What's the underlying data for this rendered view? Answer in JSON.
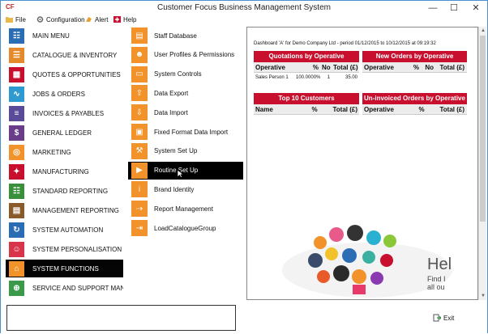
{
  "window": {
    "title": "Customer Focus Business Management System",
    "logo_text": "CF"
  },
  "menu": [
    {
      "label": "File",
      "icon": "folder-icon"
    },
    {
      "label": "Configuration",
      "icon": "gear-icon"
    },
    {
      "label": "Alert",
      "icon": "bell-icon"
    },
    {
      "label": "Help",
      "icon": "help-icon"
    }
  ],
  "nav": {
    "items": [
      {
        "label": "MAIN MENU",
        "icon": "hierarchy-icon",
        "color": "#2a6db5"
      },
      {
        "label": "CATALOGUE & INVENTORY",
        "icon": "book-icon",
        "color": "#e58a2a"
      },
      {
        "label": "QUOTES & OPPORTUNITIES",
        "icon": "calendar-icon",
        "color": "#c8102e"
      },
      {
        "label": "JOBS & ORDERS",
        "icon": "pulse-icon",
        "color": "#2e9ad0"
      },
      {
        "label": "INVOICES & PAYABLES",
        "icon": "invoice-icon",
        "color": "#5a4a9a"
      },
      {
        "label": "GENERAL LEDGER",
        "icon": "dollar-icon",
        "color": "#6a3d8a"
      },
      {
        "label": "MARKETING",
        "icon": "globe-icon",
        "color": "#f2922a"
      },
      {
        "label": "MANUFACTURING",
        "icon": "network-icon",
        "color": "#c8102e"
      },
      {
        "label": "STANDARD REPORTING",
        "icon": "report-icon",
        "color": "#3a8f3a"
      },
      {
        "label": "MANAGEMENT REPORTING",
        "icon": "chart-icon",
        "color": "#8a5a2a"
      },
      {
        "label": "SYSTEM AUTOMATION",
        "icon": "sync-icon",
        "color": "#2a6db5"
      },
      {
        "label": "SYSTEM PERSONALISATION",
        "icon": "user-icon",
        "color": "#d8344a"
      },
      {
        "label": "SYSTEM FUNCTIONS",
        "icon": "home-icon",
        "color": "#f2922a"
      },
      {
        "label": "SERVICE AND SUPPORT MANAGEMENT",
        "icon": "support-icon",
        "color": "#3a9a4a"
      }
    ],
    "selected_index": 12
  },
  "functions": {
    "items": [
      {
        "label": "Staff Database",
        "icon": "id-card-icon"
      },
      {
        "label": "User Profiles & Permissions",
        "icon": "users-icon"
      },
      {
        "label": "System Controls",
        "icon": "controls-icon"
      },
      {
        "label": "Data Export",
        "icon": "export-icon"
      },
      {
        "label": "Data Import",
        "icon": "import-icon"
      },
      {
        "label": "Fixed Format Data Import",
        "icon": "inbox-icon"
      },
      {
        "label": "System Set Up",
        "icon": "tools-icon"
      },
      {
        "label": "Routine Set Up",
        "icon": "routine-icon"
      },
      {
        "label": "Brand Identity",
        "icon": "info-icon"
      },
      {
        "label": "Report Management",
        "icon": "report-manage-icon"
      },
      {
        "label": "LoadCatalogueGroup",
        "icon": "load-icon"
      }
    ],
    "selected_index": 7
  },
  "dashboard": {
    "heading": "Dashboard 'A' for Demo Company Ltd - period 01/12/2015 to 10/12/2015 at 09:19:32",
    "quotations": {
      "title": "Quotations by Operative",
      "columns": [
        "Operative",
        "%",
        "No",
        "Total (£)"
      ],
      "rows": [
        [
          "Sales Person 1",
          "100.0000%",
          "1",
          "35.00"
        ]
      ]
    },
    "new_orders": {
      "title": "New Orders by Operative",
      "columns": [
        "Operative",
        "%",
        "No",
        "Total (£)"
      ]
    },
    "top_customers": {
      "title": "Top 10 Customers",
      "columns": [
        "Name",
        "%",
        "Total (£)"
      ]
    },
    "uninvoiced": {
      "title": "Un-invoiced Orders by Operative",
      "columns": [
        "Operative",
        "%",
        "Total (£)"
      ]
    },
    "help_banner": {
      "big": "Hel",
      "line1": "Find I",
      "line2": "all ou"
    }
  },
  "footer": {
    "exit_label": "Exit"
  },
  "colors": {
    "accent_red": "#c8102e",
    "orange": "#f2922a",
    "selected_bg": "#000000"
  }
}
